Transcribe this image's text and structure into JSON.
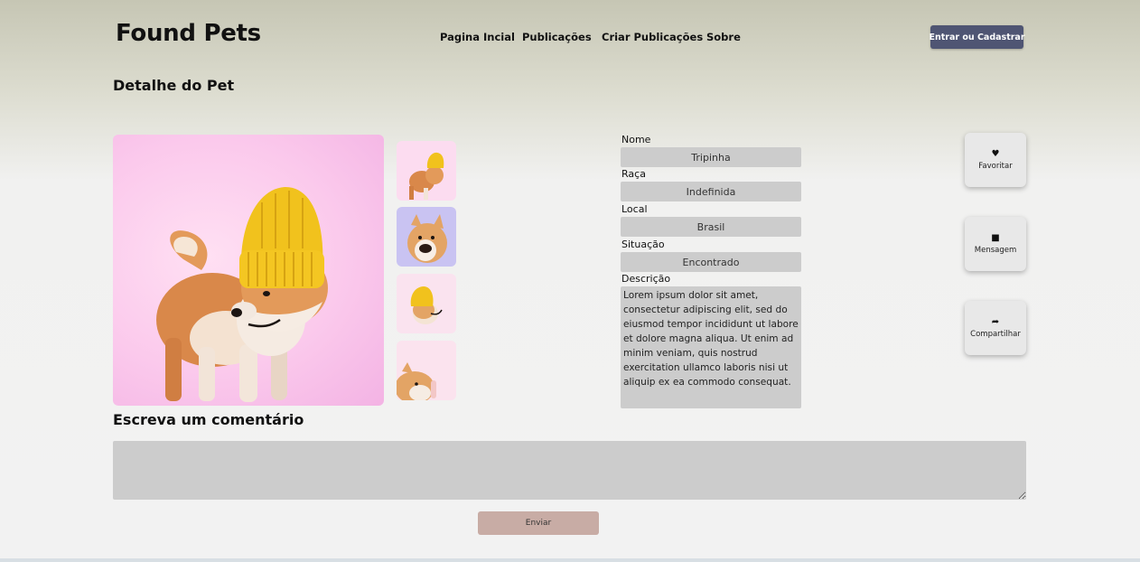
{
  "header": {
    "logo": "Found Pets",
    "nav": [
      "Pagina Incial",
      "Publicações",
      "Criar Publicações",
      "Sobre"
    ],
    "login_label": "Entrar ou Cadastrar"
  },
  "page": {
    "title": "Detalhe do Pet"
  },
  "pet": {
    "fields": [
      {
        "label": "Nome",
        "value": "Tripinha"
      },
      {
        "label": "Raça",
        "value": "Indefinida"
      },
      {
        "label": "Local",
        "value": "Brasil"
      },
      {
        "label": "Situação",
        "value": "Encontrado"
      }
    ],
    "description_label": "Descrição",
    "description": "Lorem ipsum dolor sit amet, consectetur adipiscing elit, sed do eiusmod tempor incididunt ut labore et dolore magna aliqua. Ut enim ad minim veniam, quis nostrud exercitation ullamco laboris nisi ut aliquip ex ea commodo consequat."
  },
  "actions": [
    {
      "label": "Favoritar",
      "icon": "heart-icon",
      "glyph": "♥"
    },
    {
      "label": "Mensagem",
      "icon": "message-icon",
      "glyph": "■"
    },
    {
      "label": "Compartilhar",
      "icon": "share-icon",
      "glyph": "➦"
    }
  ],
  "comment": {
    "title": "Escreva um comentário",
    "placeholder": "",
    "send_label": "Enviar"
  },
  "colors": {
    "login_button": "#4f5573",
    "send_button": "#c8aca5",
    "field_background": "#cccccc"
  }
}
